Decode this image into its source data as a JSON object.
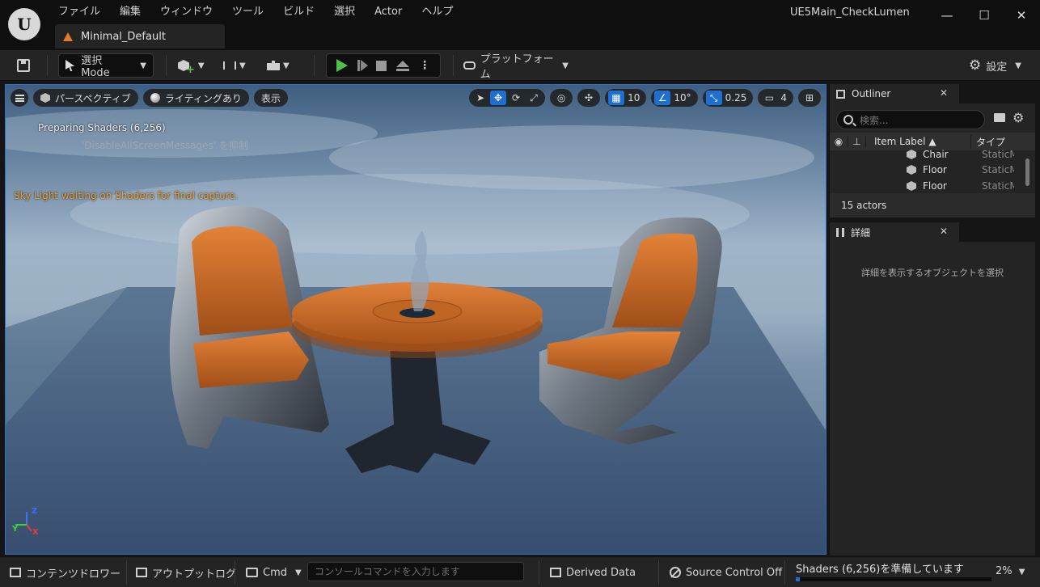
{
  "app": {
    "logo_text": "U",
    "project_name": "UE5Main_CheckLumen",
    "level_tab": "Minimal_Default"
  },
  "menu": [
    "ファイル",
    "編集",
    "ウィンドウ",
    "ツール",
    "ビルド",
    "選択",
    "Actor",
    "ヘルプ"
  ],
  "window_controls": {
    "minimize": "—",
    "maximize": "☐",
    "close": "✕"
  },
  "toolbar": {
    "mode_label": "選択 Mode",
    "platform_label": "プラットフォーム",
    "settings_label": "設定"
  },
  "viewport": {
    "menu_label": "",
    "perspective_label": "パースペクティブ",
    "lighting_label": "ライティングあり",
    "show_label": "表示",
    "grid_snap": "10",
    "rotation_snap": "10°",
    "scale_snap": "0.25",
    "camera_speed": "4",
    "msg_preparing": "Preparing Shaders (6,256)",
    "msg_disable": "'DisableAllScreenMessages' を抑制",
    "msg_skylight": "Sky Light waiting on Shaders for final capture.",
    "axis": {
      "x": "X",
      "y": "Y",
      "z": "Z"
    }
  },
  "outliner": {
    "tab_label": "Outliner",
    "search_placeholder": "検索...",
    "col_label": "Item Label ▲",
    "col_type": "タイプ",
    "rows": [
      {
        "name": "Chair",
        "type": "StaticMe"
      },
      {
        "name": "Floor",
        "type": "StaticMe"
      },
      {
        "name": "Floor",
        "type": "StaticMe"
      }
    ],
    "actor_count": "15 actors"
  },
  "details": {
    "tab_label": "詳細",
    "empty_message": "詳細を表示するオブジェクトを選択"
  },
  "statusbar": {
    "content_drawer": "コンテンツドロワー",
    "output_log": "アウトプットログ",
    "cmd_label": "Cmd",
    "console_placeholder": "コンソールコマンドを入力します",
    "derived_data": "Derived Data",
    "source_control": "Source Control Off",
    "shader_status": "Shaders (6,256)を準備しています",
    "shader_progress_fraction": 0.02,
    "shader_pct": "2%"
  },
  "colors": {
    "accent": "#1f6fd1",
    "play_green": "#4cc14c",
    "warning_orange": "#f0a030",
    "level_icon": "#e37a2e"
  }
}
